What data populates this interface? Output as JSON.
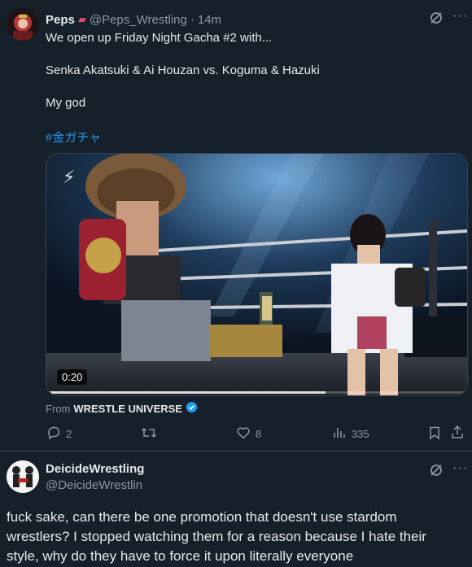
{
  "tweet1": {
    "display_name": "Peps",
    "handle": "@Peps_Wrestling",
    "separator": "·",
    "time": "14m",
    "lines": [
      "We open up Friday Night Gacha #2 with...",
      "Senka Akatsuki & Ai Houzan vs. Koguma & Hazuki",
      "My god"
    ],
    "hashtag": "#金ガチャ",
    "video_duration": "0:20",
    "from_prefix": "From",
    "from_source": "WRESTLE UNIVERSE",
    "stats": {
      "replies": "2",
      "retweets": "",
      "likes": "8",
      "views": "335"
    }
  },
  "tweet2": {
    "display_name": "DeicideWrestling",
    "handle": "@DeicideWrestlin",
    "text": "fuck sake, can there be one promotion that doesn't use stardom wrestlers? I stopped watching them for a reason because I hate their style, why do they have to force it upon literally everyone"
  },
  "icons": {
    "more": "more-icon",
    "grok": "grok-icon",
    "reply": "reply-icon",
    "retweet": "retweet-icon",
    "like": "like-icon",
    "views": "views-icon",
    "bookmark": "bookmark-icon",
    "share": "share-icon",
    "verified": "verified-icon"
  },
  "colors": {
    "background": "#15202b",
    "text": "#e7e9ea",
    "muted": "#8b98a5",
    "link": "#1d9bf0",
    "divider": "#38444d"
  }
}
